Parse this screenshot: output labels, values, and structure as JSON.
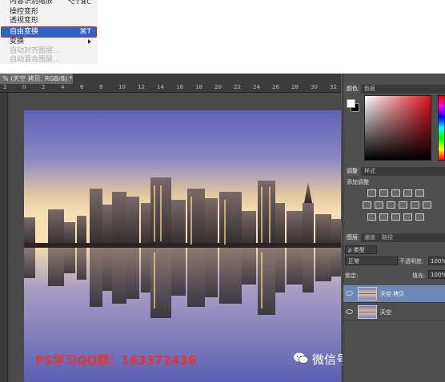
{
  "menu": {
    "items": [
      {
        "label": "内容识别缩放",
        "shortcut": "⌥⇧⌘C",
        "disabled": false
      },
      {
        "label": "操控变形",
        "shortcut": "",
        "disabled": false
      },
      {
        "label": "透视变形",
        "shortcut": "",
        "disabled": false
      },
      {
        "label": "自由变换",
        "shortcut": "⌘T",
        "disabled": false,
        "highlighted": true
      },
      {
        "label": "变换",
        "shortcut": "",
        "disabled": false,
        "submenu": true
      },
      {
        "label": "自动对齐图层...",
        "shortcut": "",
        "disabled": true
      },
      {
        "label": "自动混合图层...",
        "shortcut": "",
        "disabled": true
      }
    ]
  },
  "document": {
    "tab_title": "% (天空 拷贝, RGB/8) *",
    "close": "×",
    "ruler_ticks": [
      "2",
      "0",
      "2",
      "4",
      "6",
      "8",
      "10",
      "12",
      "14",
      "16",
      "18",
      "20",
      "22",
      "24",
      "26",
      "28",
      "30",
      "32"
    ]
  },
  "panels": {
    "color_tabs": [
      "颜色",
      "色板"
    ],
    "adjust_tabs": [
      "调整",
      "样式"
    ],
    "adjust_title": "添加调整",
    "layer_tabs": [
      "图层",
      "通道",
      "路径"
    ],
    "kind_filter": "ρ 类型",
    "blend_mode": "正常",
    "opacity_label": "不透明度:",
    "opacity_value": "100%",
    "lock_label": "锁定:",
    "fill_label": "填充:",
    "fill_value": "100%",
    "layers": [
      {
        "name": "天空 拷贝",
        "selected": true
      },
      {
        "name": "天空",
        "selected": false
      }
    ]
  },
  "watermark": {
    "left": "PS学习QQ群：163372436",
    "right": "微信号: itblwbbs"
  },
  "colors": {
    "menu_highlight": "#2f63c7",
    "highlight_border": "#c8312b",
    "watermark_red": "#e8322f",
    "layer_selected": "#6e88b4"
  }
}
